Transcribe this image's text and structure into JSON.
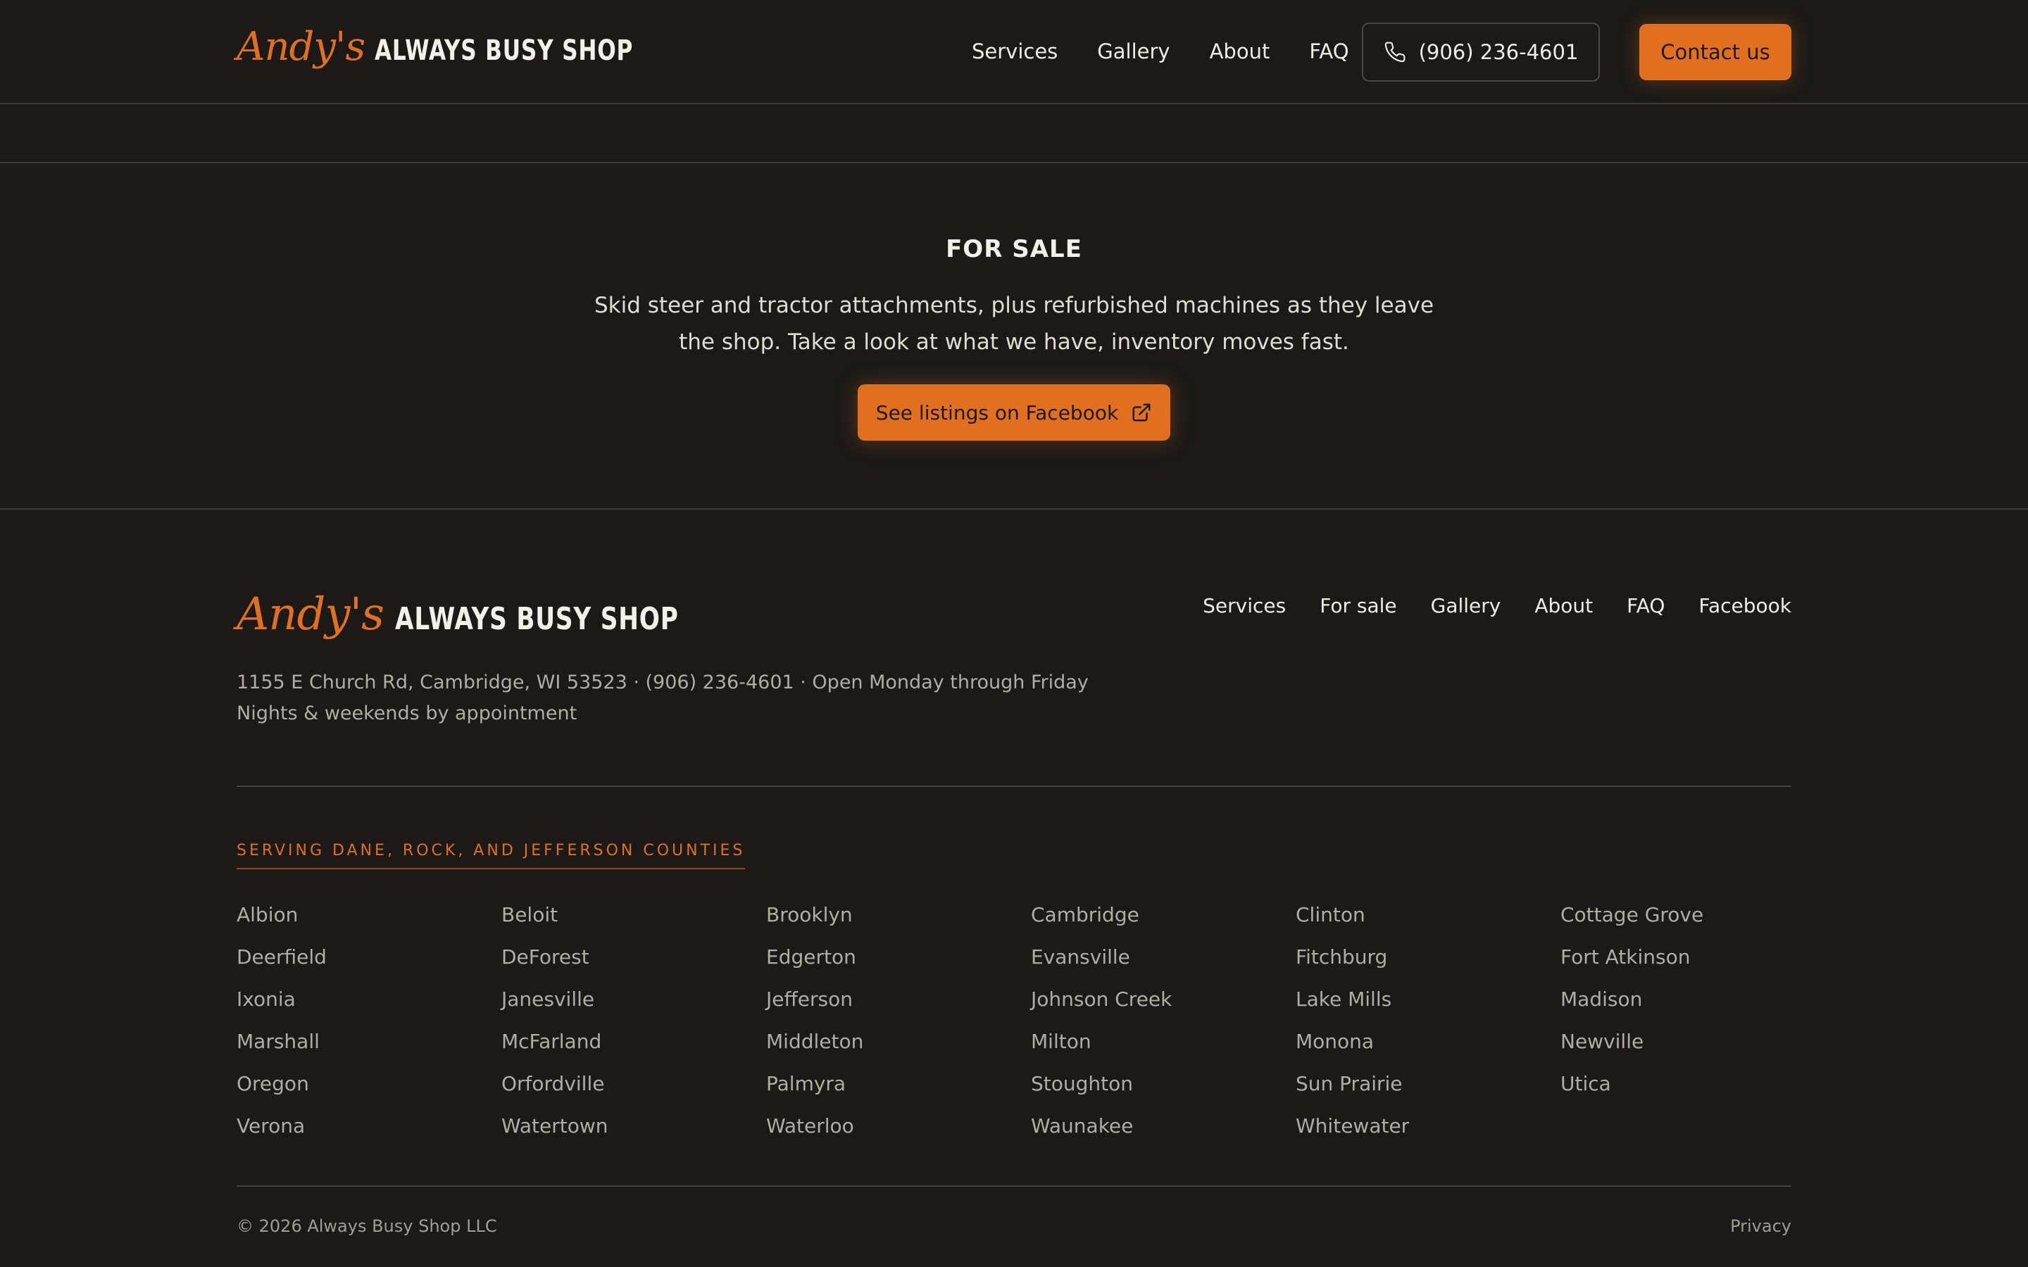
{
  "header": {
    "logo_script": "Andy's",
    "logo_name": "ALWAYS BUSY SHOP",
    "nav": [
      "Services",
      "Gallery",
      "About",
      "FAQ"
    ],
    "phone": "(906) 236-4601",
    "contact_label": "Contact us"
  },
  "for_sale": {
    "title": "FOR SALE",
    "description": "Skid steer and tractor attachments, plus refurbished machines as they leave the shop. Take a look at what we have, inventory moves fast.",
    "button_label": "See listings on Facebook"
  },
  "footer": {
    "logo_script": "Andy's",
    "logo_name": "ALWAYS BUSY SHOP",
    "nav": [
      "Services",
      "For sale",
      "Gallery",
      "About",
      "FAQ",
      "Facebook"
    ],
    "address_line": "1155 E Church Rd, Cambridge, WI 53523 · (906) 236-4601 · Open Monday through Friday",
    "hours_note": "Nights & weekends by appointment",
    "serving_heading": "SERVING DANE, ROCK, AND JEFFERSON COUNTIES",
    "towns": [
      "Albion",
      "Beloit",
      "Brooklyn",
      "Cambridge",
      "Clinton",
      "Cottage Grove",
      "Deerfield",
      "DeForest",
      "Edgerton",
      "Evansville",
      "Fitchburg",
      "Fort Atkinson",
      "Ixonia",
      "Janesville",
      "Jefferson",
      "Johnson Creek",
      "Lake Mills",
      "Madison",
      "Marshall",
      "McFarland",
      "Middleton",
      "Milton",
      "Monona",
      "Newville",
      "Oregon",
      "Orfordville",
      "Palmyra",
      "Stoughton",
      "Sun Prairie",
      "Utica",
      "Verona",
      "Watertown",
      "Waterloo",
      "Waunakee",
      "Whitewater"
    ],
    "copyright": "© 2026 Always Busy Shop LLC",
    "privacy_label": "Privacy"
  },
  "colors": {
    "background": "#1b1a18",
    "accent": "#e0701f",
    "text": "#f2ece4",
    "muted": "#b3aca2"
  },
  "icons": {
    "phone": "phone-icon",
    "external": "external-link-icon"
  }
}
